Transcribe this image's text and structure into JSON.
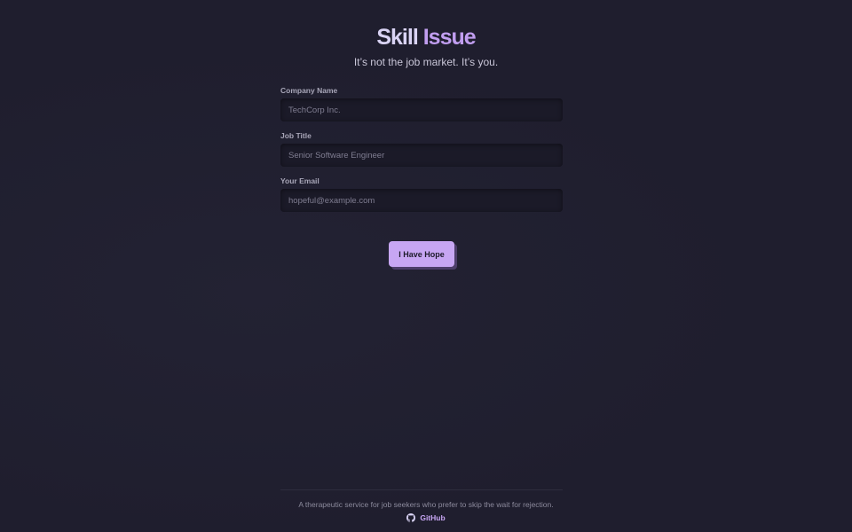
{
  "header": {
    "title_word1": "Skill",
    "title_word2": "Issue",
    "tagline": "It’s not the job market. It’s you."
  },
  "form": {
    "company": {
      "label": "Company Name",
      "placeholder": "TechCorp Inc.",
      "value": ""
    },
    "job_title": {
      "label": "Job Title",
      "placeholder": "Senior Software Engineer",
      "value": ""
    },
    "email": {
      "label": "Your Email",
      "placeholder": "hopeful@example.com",
      "value": ""
    },
    "submit_label": "I Have Hope"
  },
  "footer": {
    "text": "A therapeutic service for job seekers who prefer to skip the wait for rejection.",
    "github_label": "GitHub",
    "github_icon": "github-icon"
  },
  "colors": {
    "background": "#1f1e2e",
    "accent": "#c7a6f3",
    "title_primary": "#d9d3f4"
  }
}
